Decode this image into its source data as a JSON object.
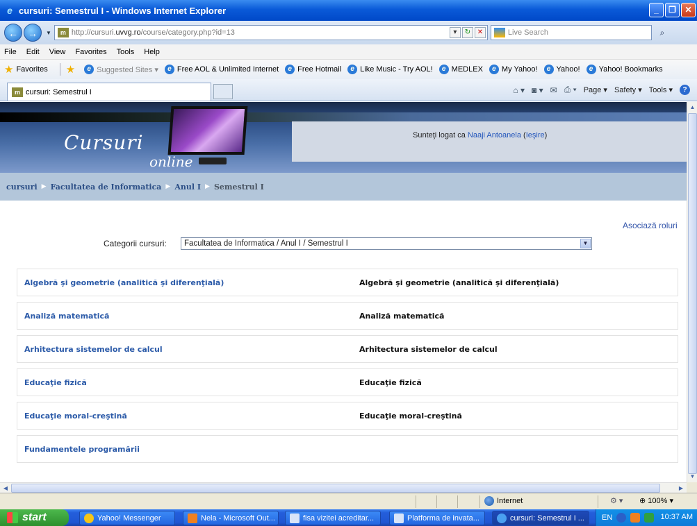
{
  "window": {
    "title": "cursuri: Semestrul I - Windows Internet Explorer"
  },
  "address_bar": {
    "url_prefix": "http://cursuri.",
    "url_host": "uvvg.ro",
    "url_suffix": "/course/category.php?id=13",
    "search_placeholder": "Live Search"
  },
  "menu": [
    "File",
    "Edit",
    "View",
    "Favorites",
    "Tools",
    "Help"
  ],
  "favorites_bar": {
    "favorites_label": "Favorites",
    "items": [
      "Suggested Sites ▾",
      "Free AOL & Unlimited Internet",
      "Free Hotmail",
      "Like Music - Try AOL!",
      "MEDLEX",
      "My Yahoo!",
      "Yahoo!",
      "Yahoo! Bookmarks"
    ]
  },
  "tab": {
    "label": "cursuri: Semestrul I"
  },
  "command_bar": {
    "page": "Page ▾",
    "safety": "Safety ▾",
    "tools": "Tools ▾"
  },
  "site": {
    "logo_main": "Cursuri",
    "logo_sub": "online",
    "login_prefix": "Sunteţi logat ca",
    "user_name": "Naaji Antoanela",
    "logout": "Ieşire"
  },
  "breadcrumb": {
    "items": [
      "cursuri",
      "Facultatea de Informatica",
      "Anul I"
    ],
    "current": "Semestrul I"
  },
  "page": {
    "assign_roles": "Asociază roluri",
    "category_label": "Categorii cursuri:",
    "category_selected": "Facultatea de Informatica / Anul I / Semestrul I"
  },
  "courses": [
    {
      "name": "Algebră şi geometrie (analitică şi diferenţială)",
      "summary": "Algebră şi geometrie (analitică şi diferenţială)"
    },
    {
      "name": "Analiză matematică",
      "summary": "Analiză matematică"
    },
    {
      "name": "Arhitectura sistemelor de calcul",
      "summary": "Arhitectura sistemelor de calcul"
    },
    {
      "name": "Educaţie fizică",
      "summary": "Educaţie fizică"
    },
    {
      "name": "Educaţie moral-creştină",
      "summary": "Educaţie moral-creştină"
    },
    {
      "name": "Fundamentele programării",
      "summary": ""
    }
  ],
  "status_bar": {
    "zone": "Internet",
    "zoom": "100%"
  },
  "taskbar": {
    "start": "start",
    "buttons": [
      "Yahoo! Messenger",
      "Nela - Microsoft Out...",
      "fisa vizitei acreditar...",
      "Platforma de invata...",
      "cursuri: Semestrul I ..."
    ],
    "lang": "EN",
    "clock": "10:37 AM"
  }
}
